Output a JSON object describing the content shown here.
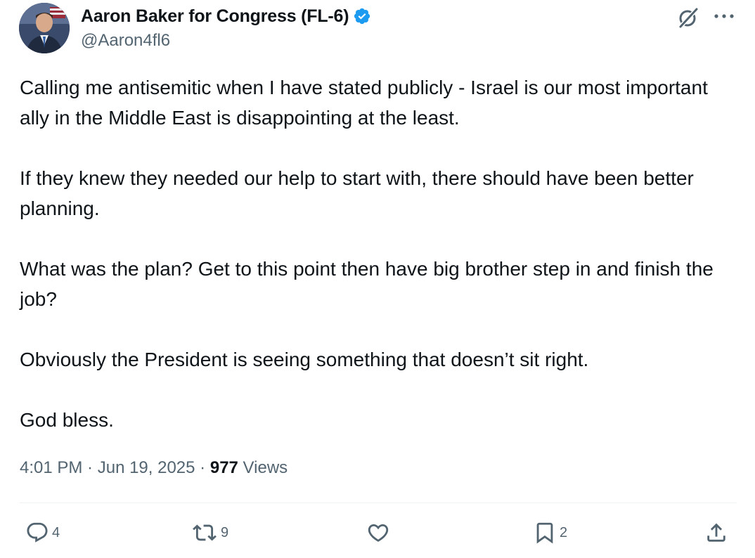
{
  "author": {
    "display_name": "Aaron Baker for Congress (FL-6)",
    "handle": "@Aaron4fl6",
    "verified": true,
    "avatar_icon": "profile-photo",
    "verified_color": "#1d9bf0"
  },
  "header_actions": {
    "grok_icon": "grok-icon",
    "more_icon": "more-horizontal-icon"
  },
  "tweet": {
    "paragraphs": [
      "Calling me antisemitic when I have stated publicly - Israel is our most important ally in the Middle East is disappointing at the least.",
      "If they knew they needed our help to start with, there should have been better planning.",
      "What was the plan? Get to this point then have big brother step in and finish the job?",
      "Obviously the President is seeing something that doesn’t sit right.",
      "God bless."
    ],
    "time": "4:01 PM",
    "separator": " · ",
    "date": "Jun 19, 2025",
    "views_count": "977",
    "views_label": " Views"
  },
  "actions": {
    "reply": {
      "icon": "reply-icon",
      "count": "4"
    },
    "repost": {
      "icon": "repost-icon",
      "count": "9"
    },
    "like": {
      "icon": "heart-icon",
      "count": ""
    },
    "bookmark": {
      "icon": "bookmark-icon",
      "count": "2"
    },
    "share": {
      "icon": "share-icon",
      "count": ""
    }
  },
  "colors": {
    "text_primary": "#0f1419",
    "text_secondary": "#536471",
    "divider": "#eff3f4"
  }
}
